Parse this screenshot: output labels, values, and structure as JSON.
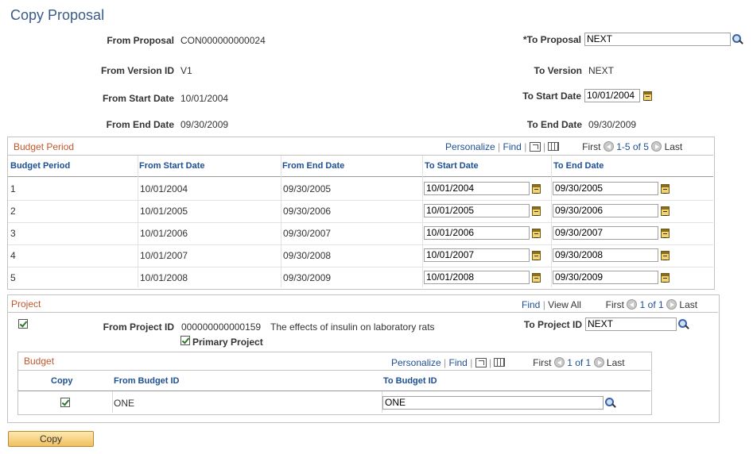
{
  "page": {
    "title": "Copy Proposal"
  },
  "header": {
    "from_proposal_label": "From Proposal",
    "from_proposal_value": "CON000000000024",
    "from_version_label": "From Version ID",
    "from_version_value": "V1",
    "from_start_label": "From Start Date",
    "from_start_value": "10/01/2004",
    "from_end_label": "From End Date",
    "from_end_value": "09/30/2009",
    "to_proposal_label": "*To Proposal",
    "to_proposal_value": "NEXT",
    "to_version_label": "To Version",
    "to_version_value": "NEXT",
    "to_start_label": "To Start Date",
    "to_start_value": "10/01/2004",
    "to_end_label": "To End Date",
    "to_end_value": "09/30/2009"
  },
  "budget_period": {
    "title": "Budget Period",
    "personalize": "Personalize",
    "find": "Find",
    "first": "First",
    "range": "1-5 of 5",
    "last": "Last",
    "columns": [
      "Budget Period",
      "From Start Date",
      "From End Date",
      "To Start Date",
      "To End Date"
    ],
    "rows": [
      {
        "period": "1",
        "from_start": "10/01/2004",
        "from_end": "09/30/2005",
        "to_start": "10/01/2004",
        "to_end": "09/30/2005"
      },
      {
        "period": "2",
        "from_start": "10/01/2005",
        "from_end": "09/30/2006",
        "to_start": "10/01/2005",
        "to_end": "09/30/2006"
      },
      {
        "period": "3",
        "from_start": "10/01/2006",
        "from_end": "09/30/2007",
        "to_start": "10/01/2006",
        "to_end": "09/30/2007"
      },
      {
        "period": "4",
        "from_start": "10/01/2007",
        "from_end": "09/30/2008",
        "to_start": "10/01/2007",
        "to_end": "09/30/2008"
      },
      {
        "period": "5",
        "from_start": "10/01/2008",
        "from_end": "09/30/2009",
        "to_start": "10/01/2008",
        "to_end": "09/30/2009"
      }
    ]
  },
  "project": {
    "title": "Project",
    "find": "Find",
    "view_all": "View All",
    "first": "First",
    "range": "1 of 1",
    "last": "Last",
    "from_project_label": "From Project ID",
    "from_project_value": "000000000000159",
    "from_project_desc": "The effects of insulin on laboratory rats",
    "primary_label": "Primary Project",
    "to_project_label": "To Project ID",
    "to_project_value": "NEXT"
  },
  "budget": {
    "title": "Budget",
    "personalize": "Personalize",
    "find": "Find",
    "first": "First",
    "range": "1 of 1",
    "last": "Last",
    "columns": [
      "Copy",
      "From Budget ID",
      "To Budget ID"
    ],
    "row": {
      "from_budget": "ONE",
      "to_budget": "ONE"
    }
  },
  "actions": {
    "copy_button": "Copy"
  }
}
